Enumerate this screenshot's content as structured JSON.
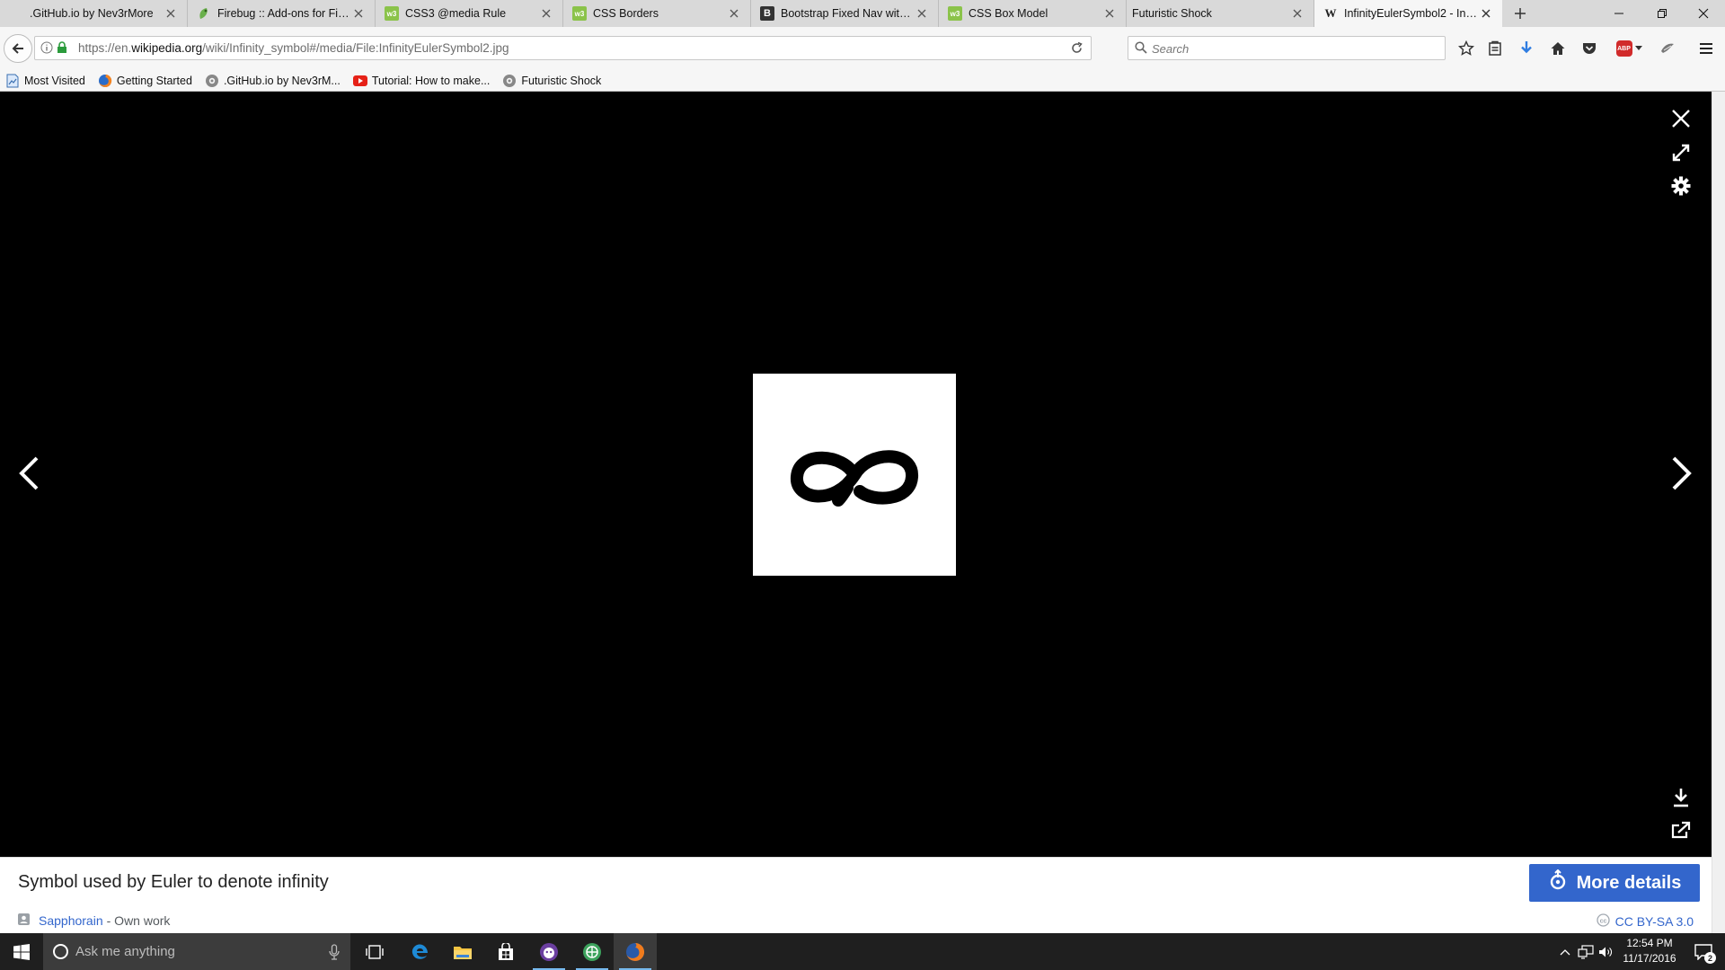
{
  "browser": {
    "tabs": [
      {
        "title": ".GitHub.io by Nev3rMore",
        "icon": "github-icon",
        "active": false
      },
      {
        "title": "Firebug :: Add-ons for Fire...",
        "icon": "firebug-icon",
        "active": false
      },
      {
        "title": "CSS3 @media Rule",
        "icon": "w3schools-icon",
        "active": false
      },
      {
        "title": "CSS Borders",
        "icon": "w3schools-icon",
        "active": false
      },
      {
        "title": "Bootstrap Fixed Nav with ...",
        "icon": "bootply-icon",
        "active": false
      },
      {
        "title": "CSS Box Model",
        "icon": "w3schools-icon",
        "active": false
      },
      {
        "title": "Futuristic Shock",
        "icon": "blank-icon",
        "active": false
      },
      {
        "title": "InfinityEulerSymbol2 - Infi...",
        "icon": "wikipedia-icon",
        "active": true
      }
    ],
    "url": {
      "prefix": "https://en.",
      "domain": "wikipedia.org",
      "path": "/wiki/Infinity_symbol#/media/File:InfinityEulerSymbol2.jpg"
    },
    "search_placeholder": "Search",
    "addon_badge": "ABP",
    "bookmarks": [
      {
        "label": "Most Visited",
        "icon": "most-visited-icon"
      },
      {
        "label": "Getting Started",
        "icon": "firefox-icon"
      },
      {
        "label": ".GitHub.io by Nev3rM...",
        "icon": "github-icon"
      },
      {
        "label": "Tutorial: How to make...",
        "icon": "youtube-icon"
      },
      {
        "label": "Futuristic Shock",
        "icon": "github-icon"
      }
    ]
  },
  "media_viewer": {
    "caption": "Symbol used by Euler to denote infinity",
    "more_details_label": "More details",
    "author": "Sapphorain",
    "source": "- Own work",
    "license": "CC BY-SA 3.0"
  },
  "taskbar": {
    "search_placeholder": "Ask me anything",
    "time": "12:54 PM",
    "date": "11/17/2016",
    "notification_count": "2"
  },
  "colors": {
    "viewer_bg": "#000000",
    "more_details_bg": "#3366cc",
    "link": "#3366cc",
    "taskbar_bg": "#1f1f1f"
  }
}
